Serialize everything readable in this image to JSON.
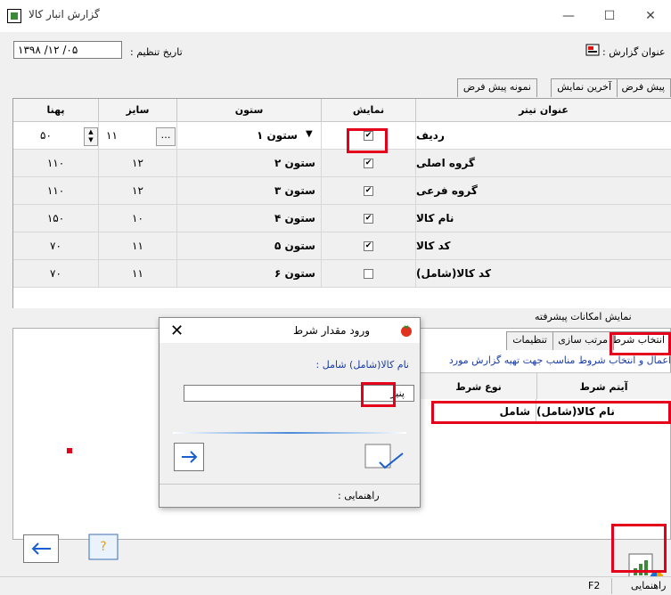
{
  "window": {
    "title": "گزارش انبار کالا",
    "minimize": "—",
    "maximize": "☐",
    "close": "✕"
  },
  "header": {
    "report_title_label": "عنوان گزارش :",
    "date_label": "تاریخ تنظیم :",
    "date_value": "۱۳۹۸ /۱۲ /۰۵"
  },
  "top_tabs": [
    "پیش فرض",
    "آخرین نمایش",
    "نمونه پیش فرض"
  ],
  "grid": {
    "headers": {
      "title": "عنوان تیتر",
      "show": "نمایش",
      "column": "ستون",
      "size": "سایز",
      "width": "پهنا"
    },
    "rows": [
      {
        "title": "ردیف",
        "show": true,
        "column": "ستون ۱",
        "size": "۱۱",
        "width": "۵۰"
      },
      {
        "title": "گروه اصلی",
        "show": true,
        "column": "ستون ۲",
        "size": "۱۲",
        "width": "۱۱۰"
      },
      {
        "title": "گروه فرعی",
        "show": true,
        "column": "ستون ۳",
        "size": "۱۲",
        "width": "۱۱۰"
      },
      {
        "title": "نام کالا",
        "show": true,
        "column": "ستون ۴",
        "size": "۱۰",
        "width": "۱۵۰"
      },
      {
        "title": "کد کالا",
        "show": true,
        "column": "ستون ۵",
        "size": "۱۱",
        "width": "۷۰"
      },
      {
        "title": "کد کالا(شامل)",
        "show": false,
        "column": "ستون ۶",
        "size": "۱۱",
        "width": "۷۰"
      }
    ]
  },
  "advanced": {
    "label": "نمایش امکانات پیشرفته"
  },
  "bottom_tabs": [
    "انتخاب شرط",
    "مرتب سازی",
    "تنظیمات"
  ],
  "condition": {
    "description": "اعمال و انتخاب شروط مناسب جهت تهیه گزارش  مورد",
    "headers": {
      "item": "آیتم شرط",
      "type": "نوع شرط"
    },
    "row": {
      "item": "نام کالا(شامل)",
      "type": "شامل"
    }
  },
  "dialog": {
    "title": "ورود مقدار شرط",
    "close": "✕",
    "field_label": "نام کالا(شامل) شامل :",
    "field_value": "پنیر",
    "help_label": "راهنمایی :"
  },
  "status": {
    "key": "F2",
    "help": "راهنمایی"
  }
}
